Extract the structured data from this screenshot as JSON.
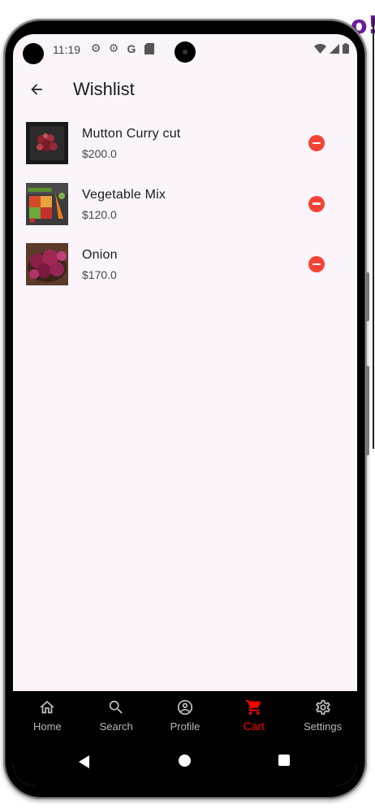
{
  "status_bar": {
    "time": "11:19",
    "icons": [
      "gear-icon",
      "gear-icon",
      "google-icon",
      "sd-card-icon"
    ],
    "right_icons": [
      "wifi-icon",
      "signal-icon",
      "battery-icon"
    ]
  },
  "app_bar": {
    "title": "Wishlist",
    "back_icon": "arrow-back-icon"
  },
  "wishlist": {
    "items": [
      {
        "name": "Mutton Curry cut",
        "price": "$200.0",
        "image": "mutton-curry-cut-photo"
      },
      {
        "name": "Vegetable Mix",
        "price": "$120.0",
        "image": "vegetable-mix-photo"
      },
      {
        "name": "Onion",
        "price": "$170.0",
        "image": "onion-photo"
      }
    ],
    "remove_icon": "remove-circle-icon",
    "remove_color": "#f44336"
  },
  "bottom_nav": {
    "items": [
      {
        "label": "Home",
        "icon": "home-icon",
        "active": false
      },
      {
        "label": "Search",
        "icon": "search-icon",
        "active": false
      },
      {
        "label": "Profile",
        "icon": "profile-icon",
        "active": false
      },
      {
        "label": "Cart",
        "icon": "cart-icon",
        "active": true
      },
      {
        "label": "Settings",
        "icon": "settings-icon",
        "active": false
      }
    ],
    "active_color": "#ff0000",
    "inactive_color": "#b8b8b8"
  },
  "colors": {
    "screen_background": "#fcf4fb",
    "nav_background": "#000000"
  }
}
